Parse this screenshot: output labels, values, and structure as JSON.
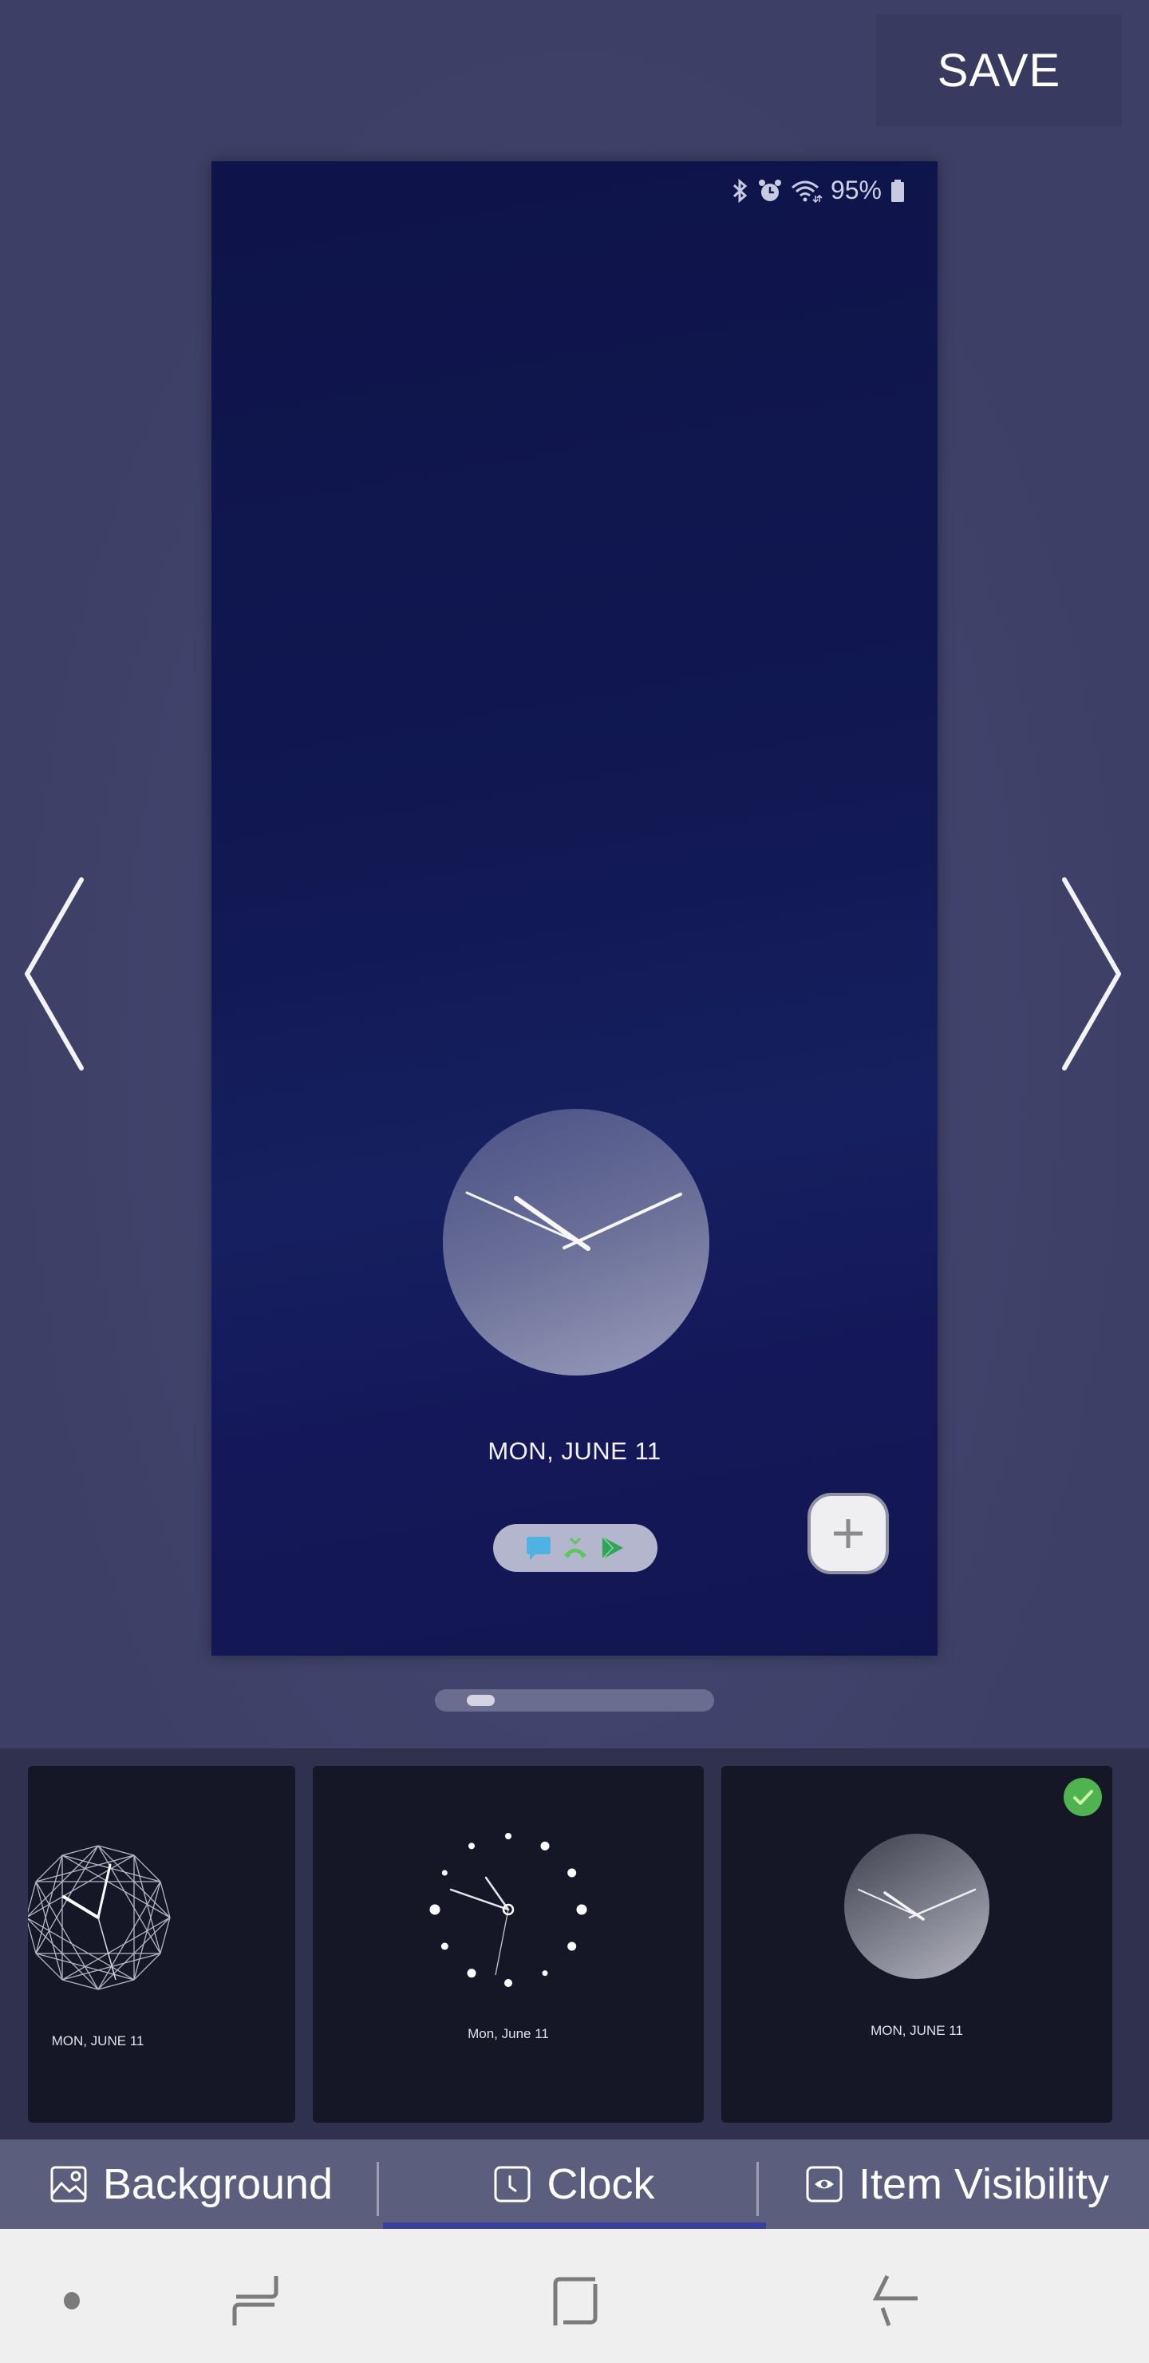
{
  "toolbar": {
    "save_label": "SAVE"
  },
  "navigation": {
    "prev_label": "previous",
    "next_label": "next"
  },
  "preview": {
    "status_bar": {
      "icons": [
        "bluetooth-icon",
        "alarm-icon",
        "wifi-icon",
        "battery-icon"
      ],
      "battery_percent": "95%"
    },
    "clock": {
      "style": "analog-gradient-circle",
      "time": "10:14"
    },
    "date": "MON, JUNE 11",
    "shortcuts": [
      "messages-icon",
      "missed-call-icon",
      "play-store-icon"
    ],
    "add_button_icon": "plus-icon"
  },
  "pager": {
    "current_page": 1,
    "total_pages": 6
  },
  "clock_styles": [
    {
      "name": "geometric",
      "date": "MON, JUNE 11",
      "selected": false
    },
    {
      "name": "dotted",
      "date": "Mon, June 11",
      "selected": false
    },
    {
      "name": "gradient-circle",
      "date": "MON, JUNE 11",
      "selected": true
    }
  ],
  "tabs": [
    {
      "label": "Background",
      "icon": "image-icon",
      "active": false
    },
    {
      "label": "Clock",
      "icon": "clock-icon",
      "active": true
    },
    {
      "label": "Item Visibility",
      "icon": "eye-icon",
      "active": false
    }
  ],
  "system_nav": [
    "dot",
    "recents",
    "home",
    "back"
  ],
  "colors": {
    "accent": "#3a3f9e",
    "selected_check": "#4fb34f",
    "tab_bar": "#5b5e7c"
  }
}
